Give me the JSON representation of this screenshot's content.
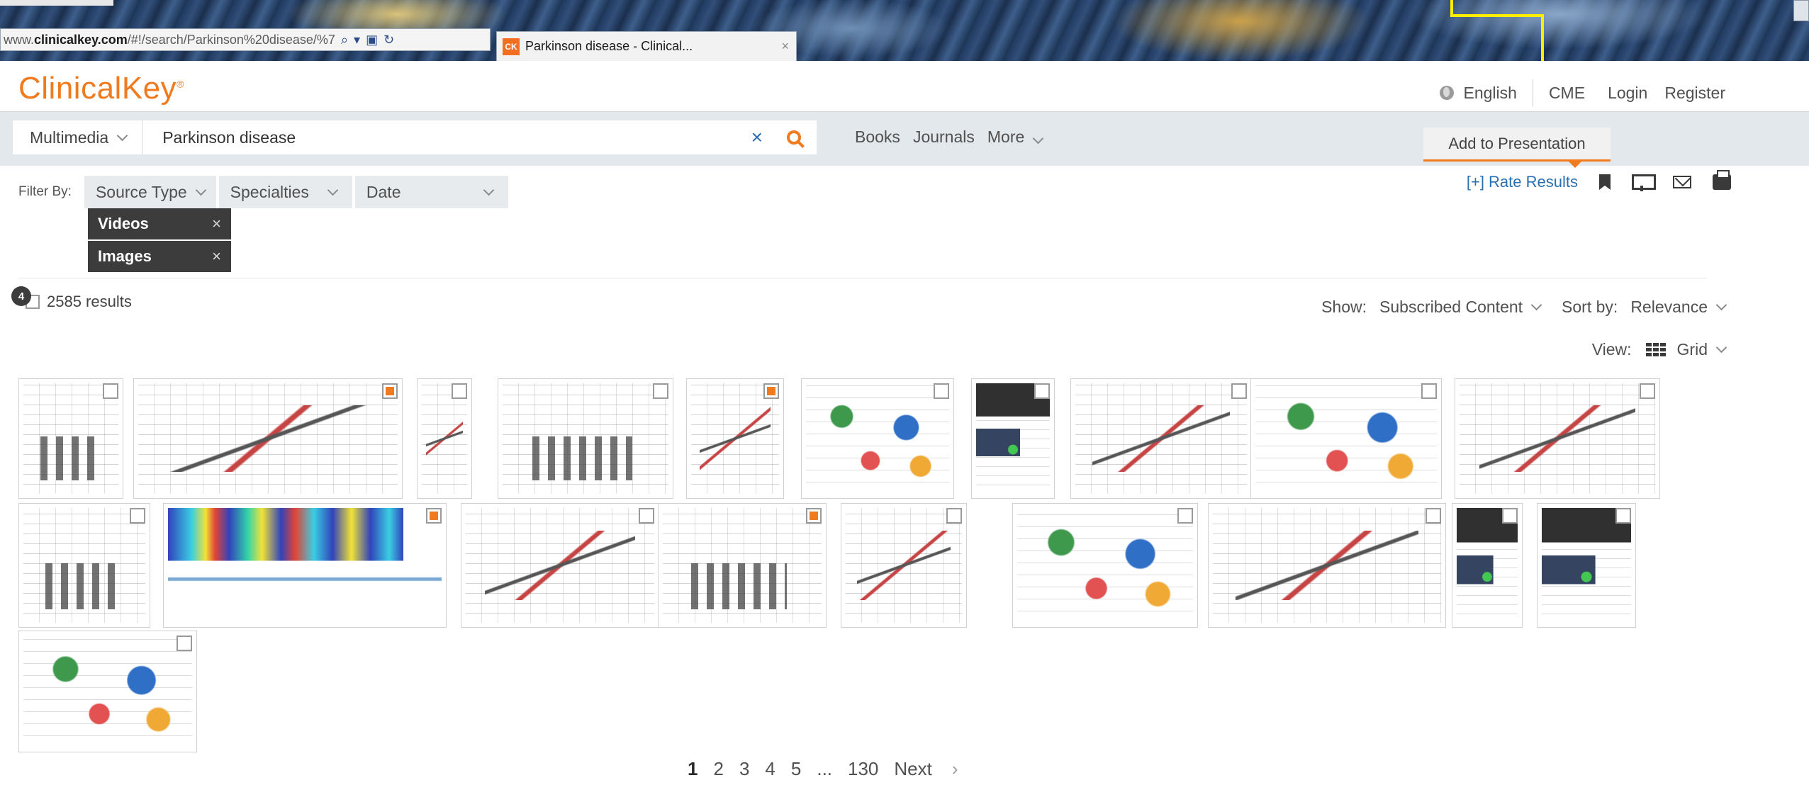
{
  "browser": {
    "url_prefix": "www.",
    "url_domain": "clinicalkey.com",
    "url_path": "/#!/search/Parkinson%20disease/%7",
    "tab_favicon": "CK",
    "tab_title": "Parkinson disease - Clinical...",
    "tab_close": "×"
  },
  "header": {
    "logo": "ClinicalKey",
    "logo_mark": "®",
    "language": "English",
    "cme": "CME",
    "login": "Login",
    "register": "Register"
  },
  "search": {
    "scope": "Multimedia",
    "query": "Parkinson disease",
    "clear": "×",
    "nav_books": "Books",
    "nav_journals": "Journals",
    "nav_more": "More"
  },
  "tooltip": {
    "add_to_presentation": "Add to Presentation"
  },
  "filters": {
    "label": "Filter By:",
    "source_type": "Source Type",
    "specialties": "Specialties",
    "date": "Date",
    "chips": [
      {
        "label": "Videos",
        "remove": "×"
      },
      {
        "label": "Images",
        "remove": "×"
      }
    ]
  },
  "tools": {
    "rate_results": "[+] Rate Results"
  },
  "results": {
    "selected_count": "4",
    "count_text": "2585 results",
    "show_label": "Show:",
    "show_value": "Subscribed Content",
    "sort_label": "Sort by:",
    "sort_value": "Relevance",
    "view_label": "View:",
    "view_value": "Grid"
  },
  "thumbnails": [
    {
      "checked": false
    },
    {
      "checked": true
    },
    {
      "checked": false
    },
    {
      "checked": false
    },
    {
      "checked": true
    },
    {
      "checked": false
    },
    {
      "checked": false
    },
    {
      "checked": false
    },
    {
      "checked": false
    },
    {
      "checked": false
    },
    {
      "checked": false
    },
    {
      "checked": true
    },
    {
      "checked": false
    },
    {
      "checked": true
    },
    {
      "checked": false
    },
    {
      "checked": false
    },
    {
      "checked": false
    },
    {
      "checked": false
    },
    {
      "checked": false
    },
    {
      "checked": false
    }
  ],
  "pagination": {
    "pages": [
      "1",
      "2",
      "3",
      "4",
      "5"
    ],
    "ellipsis": "...",
    "last": "130",
    "next": "Next",
    "next_chevron": "›"
  },
  "colors": {
    "brand_orange": "#f07a1e",
    "link_blue": "#2a6fb0",
    "annotation_yellow": "#ffee00"
  }
}
